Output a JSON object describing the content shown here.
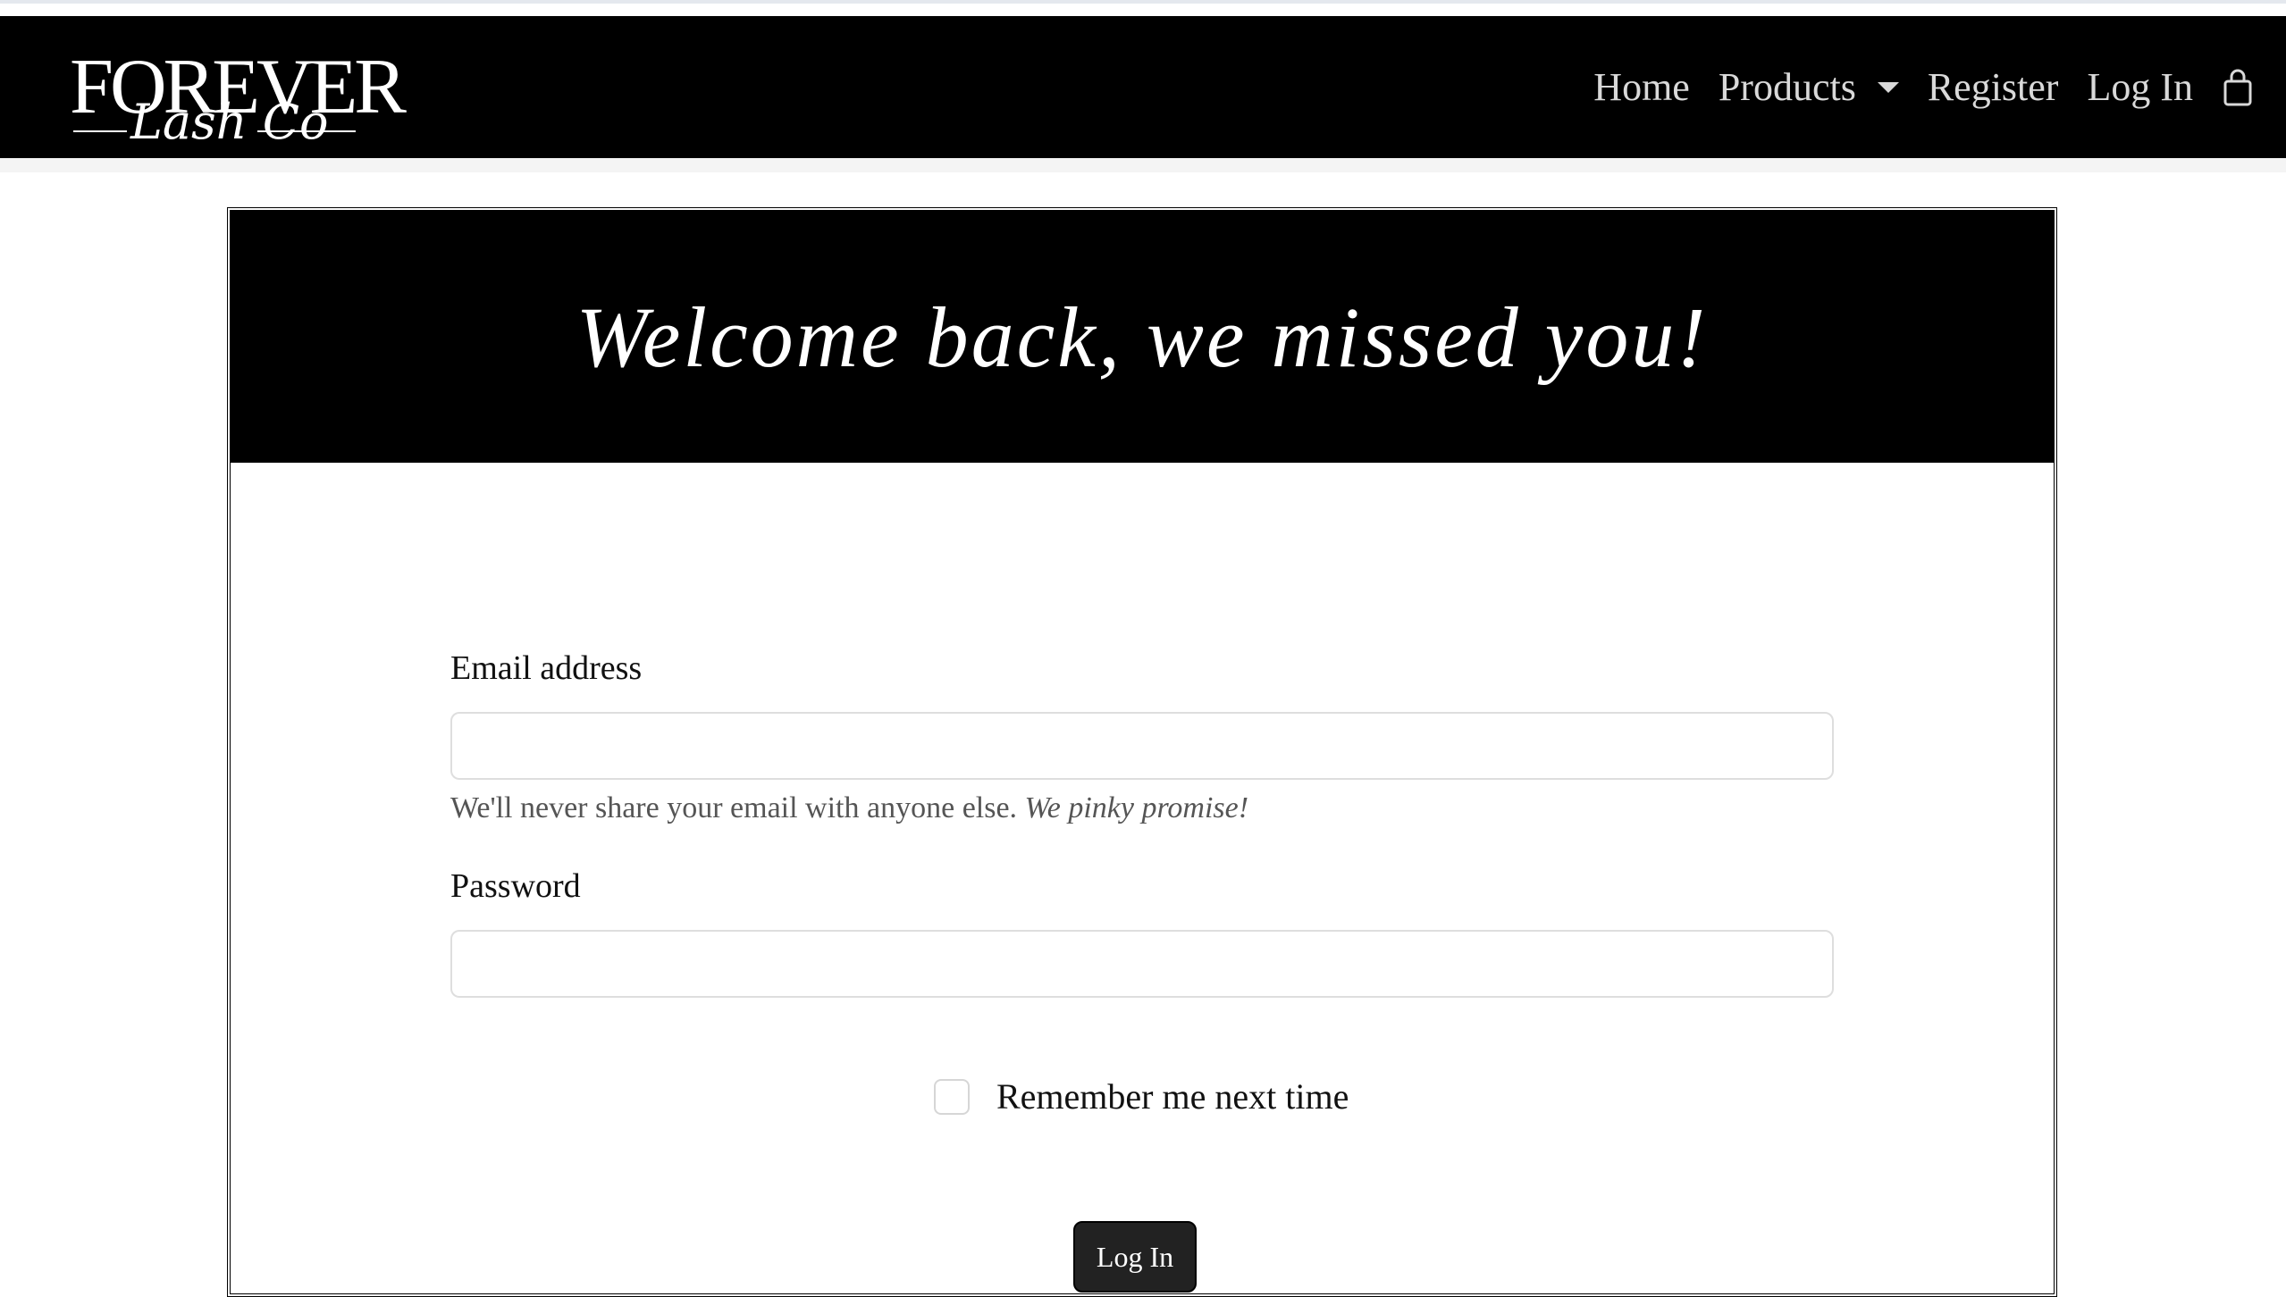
{
  "brand": {
    "logo_main": "FOREVER",
    "logo_script": "Lash Co"
  },
  "nav": {
    "home": "Home",
    "products": "Products",
    "register": "Register",
    "login": "Log In",
    "cart_icon": "shopping-bag-icon"
  },
  "card": {
    "title": "Welcome back, we missed you!"
  },
  "form": {
    "email_label": "Email address",
    "email_value": "",
    "email_help": "We'll never share your email with anyone else.",
    "email_help_emphasis": "We pinky promise!",
    "password_label": "Password",
    "password_value": "",
    "remember_label": "Remember me next time",
    "remember_checked": false,
    "submit_label": "Log In"
  },
  "colors": {
    "navbar_bg": "#000000",
    "nav_text": "#d9d9d9",
    "card_header_bg": "#000000",
    "button_bg": "#222222"
  }
}
